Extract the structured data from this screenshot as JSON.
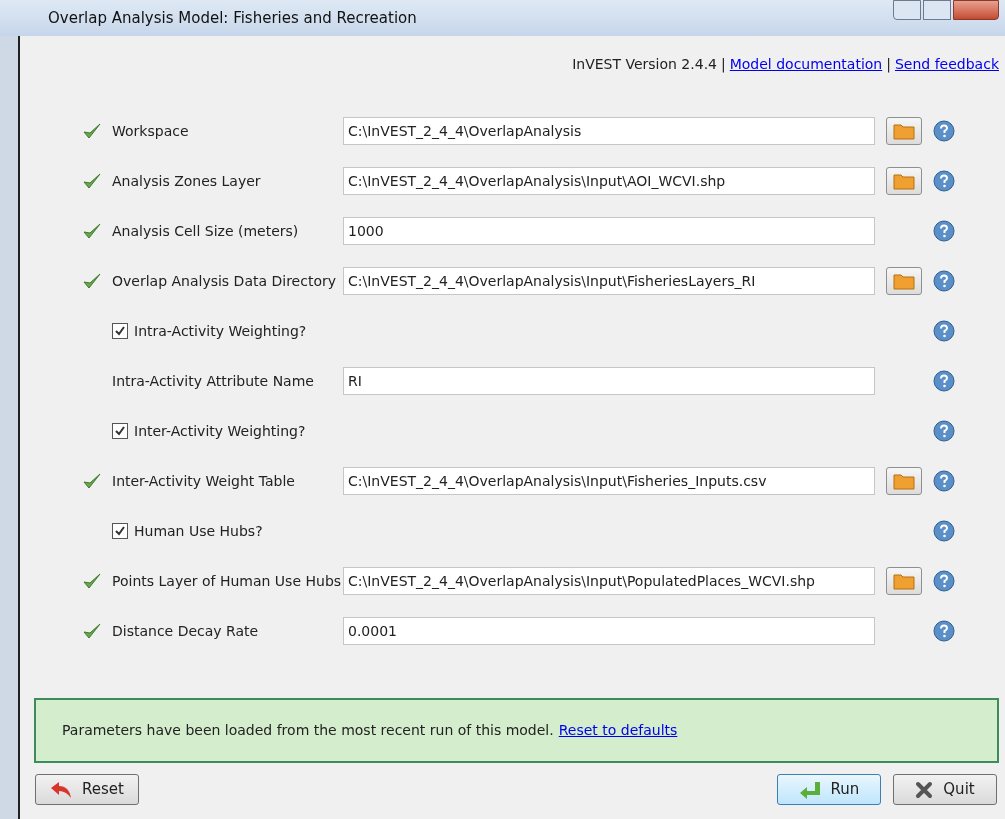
{
  "window": {
    "title": "Overlap Analysis Model: Fisheries and Recreation"
  },
  "header": {
    "version": "InVEST Version 2.4.4",
    "links": [
      {
        "separator": "|",
        "label": "Model documentation"
      },
      {
        "separator": "|",
        "label": "Send feedback"
      }
    ]
  },
  "rows": [
    {
      "kind": "file",
      "label": "Workspace",
      "value": "C:\\InVEST_2_4_4\\OverlapAnalysis",
      "valid": true
    },
    {
      "kind": "file",
      "label": "Analysis Zones Layer",
      "value": "C:\\InVEST_2_4_4\\OverlapAnalysis\\Input\\AOI_WCVI.shp",
      "valid": true
    },
    {
      "kind": "text",
      "label": "Analysis Cell Size (meters)",
      "value": "1000",
      "valid": true
    },
    {
      "kind": "file",
      "label": "Overlap Analysis Data Directory",
      "value": "C:\\InVEST_2_4_4\\OverlapAnalysis\\Input\\FisheriesLayers_RI",
      "valid": true
    },
    {
      "kind": "checkbox",
      "label": "Intra-Activity Weighting?",
      "checked": true
    },
    {
      "kind": "text",
      "label": "Intra-Activity Attribute Name",
      "value": "RI",
      "valid": false
    },
    {
      "kind": "checkbox",
      "label": "Inter-Activity Weighting?",
      "checked": true
    },
    {
      "kind": "file",
      "label": "Inter-Activity Weight Table",
      "value": "C:\\InVEST_2_4_4\\OverlapAnalysis\\Input\\Fisheries_Inputs.csv",
      "valid": true
    },
    {
      "kind": "checkbox",
      "label": "Human Use Hubs?",
      "checked": true
    },
    {
      "kind": "file",
      "label": "Points Layer of Human Use Hubs",
      "value": "C:\\InVEST_2_4_4\\OverlapAnalysis\\Input\\PopulatedPlaces_WCVI.shp",
      "valid": true
    },
    {
      "kind": "text",
      "label": "Distance Decay Rate",
      "value": "0.0001",
      "valid": true
    }
  ],
  "message": {
    "text": "Parameters have been loaded from the most recent run of this model.",
    "link": "Reset to defaults"
  },
  "buttons": [
    {
      "kind": "reset",
      "label": "Reset"
    },
    {
      "kind": "run",
      "label": "Run"
    },
    {
      "kind": "quit",
      "label": "Quit"
    }
  ]
}
